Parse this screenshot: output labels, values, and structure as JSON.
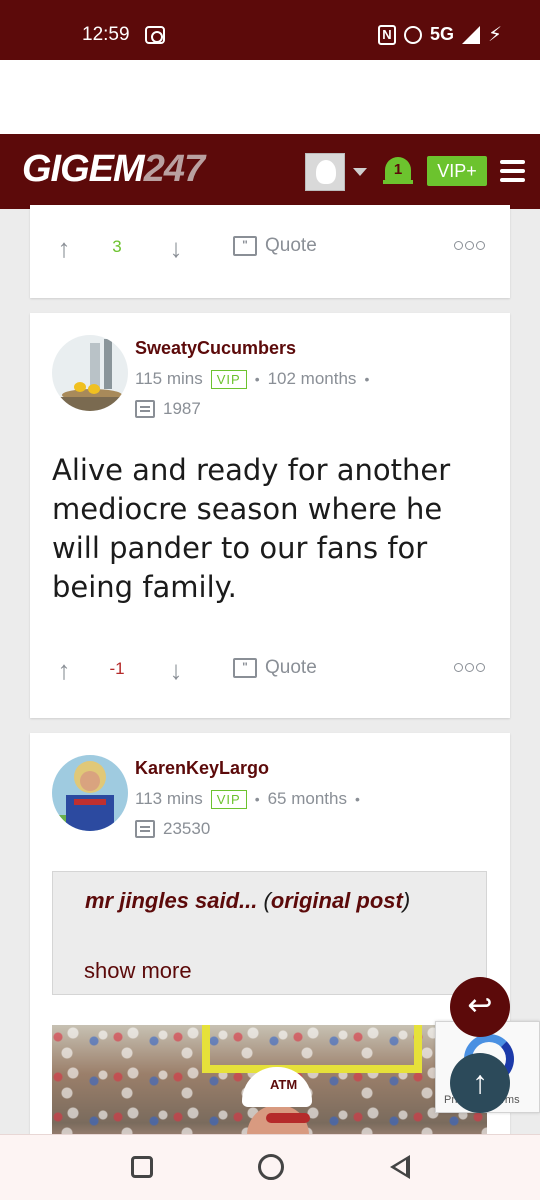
{
  "status_bar": {
    "time": "12:59",
    "network": "5G"
  },
  "header": {
    "logo_text": "GIGEM",
    "logo_number": "247",
    "notification_count": "1",
    "vip_label": "VIP+"
  },
  "post_prev": {
    "votes": "3",
    "quote_label": "Quote"
  },
  "post1": {
    "username": "SweatyCucumbers",
    "time_ago": "115 mins",
    "badge": "VIP",
    "member_for": "102 months",
    "post_count": "1987",
    "body": "Alive and ready for another mediocre season where he will pander to our fans for being family.",
    "votes": "-1",
    "quote_label": "Quote"
  },
  "post2": {
    "username": "KarenKeyLargo",
    "time_ago": "113 mins",
    "badge": "VIP",
    "member_for": "65 months",
    "post_count": "23530",
    "quote_author": "mr jingles said...",
    "quote_link": "original post",
    "show_more": "show more"
  },
  "recaptcha": {
    "text": "Privacy - Terms"
  },
  "colors": {
    "maroon": "#5c0a0a",
    "green": "#6cc32e",
    "grey_text": "#8a8f96"
  }
}
